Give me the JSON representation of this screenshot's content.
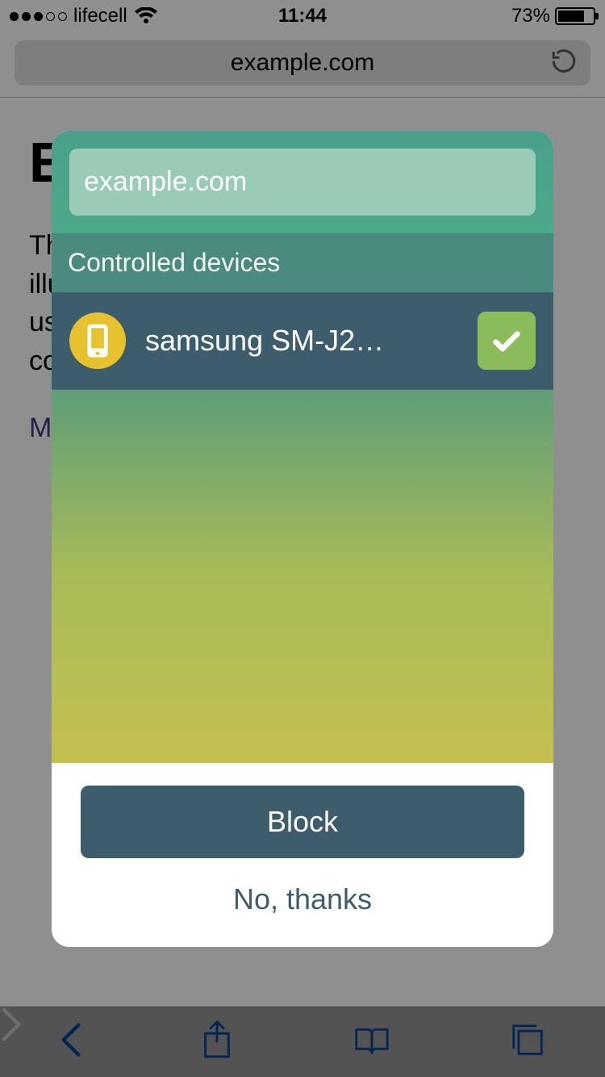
{
  "status_bar": {
    "carrier": "lifecell",
    "time": "11:44",
    "battery_percent": "73%"
  },
  "browser": {
    "url": "example.com"
  },
  "background_page": {
    "title": "E",
    "body_lines": [
      "Th",
      "illu",
      "us",
      "co"
    ],
    "link": "Mo"
  },
  "modal": {
    "domain": "example.com",
    "section_title": "Controlled devices",
    "devices": [
      {
        "name": "samsung SM-J2…",
        "selected": true
      }
    ],
    "block_label": "Block",
    "nothanks_label": "No, thanks"
  }
}
